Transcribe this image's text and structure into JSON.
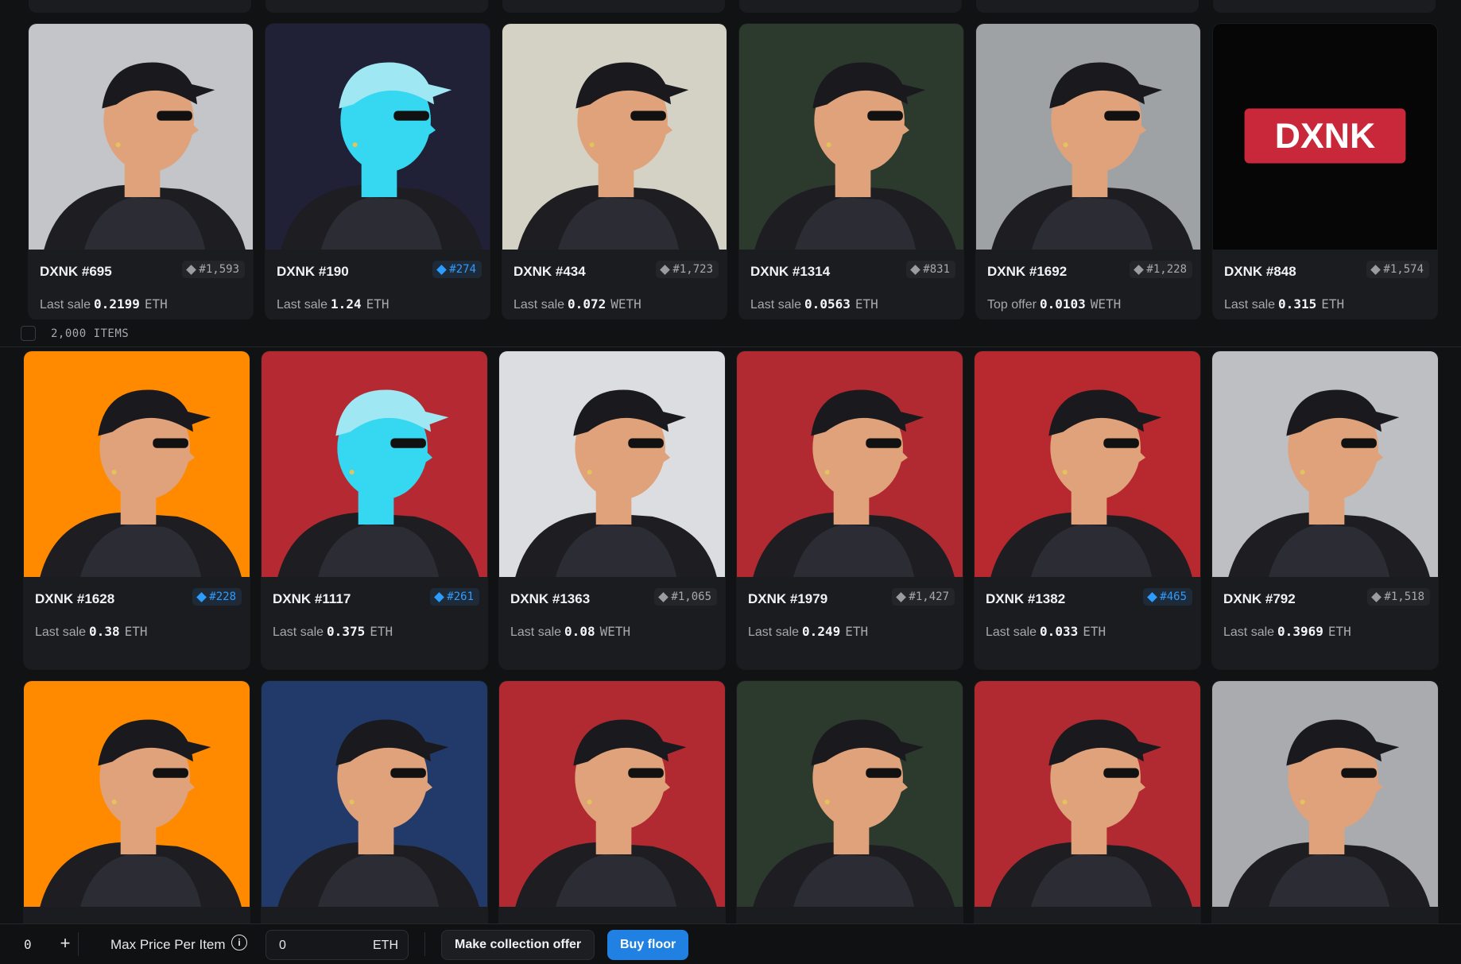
{
  "items_bar": {
    "count_label": "2,000 ITEMS"
  },
  "top_row": [
    {
      "name": "DXNK #695",
      "rank": "#1,593",
      "rank_blue": false,
      "sale_label": "Last sale",
      "price": "0.2199",
      "currency": "ETH",
      "bg": "#c3c5c8",
      "art": "person"
    },
    {
      "name": "DXNK #190",
      "rank": "#274",
      "rank_blue": true,
      "sale_label": "Last sale",
      "price": "1.24",
      "currency": "ETH",
      "bg": "#202036",
      "art": "skull"
    },
    {
      "name": "DXNK #434",
      "rank": "#1,723",
      "rank_blue": false,
      "sale_label": "Last sale",
      "price": "0.072",
      "currency": "WETH",
      "bg": "#d3d2c4",
      "art": "person"
    },
    {
      "name": "DXNK #1314",
      "rank": "#831",
      "rank_blue": false,
      "sale_label": "Last sale",
      "price": "0.0563",
      "currency": "ETH",
      "bg": "#2c3a2e",
      "art": "person"
    },
    {
      "name": "DXNK #1692",
      "rank": "#1,228",
      "rank_blue": false,
      "sale_label": "Top offer",
      "price": "0.0103",
      "currency": "WETH",
      "bg": "#9fa2a5",
      "art": "person"
    },
    {
      "name": "DXNK #848",
      "rank": "#1,574",
      "rank_blue": false,
      "sale_label": "Last sale",
      "price": "0.315",
      "currency": "ETH",
      "bg": "#060606",
      "art": "logo",
      "logo_text": "DXNK"
    }
  ],
  "middle_row": [
    {
      "name": "DXNK #1628",
      "rank": "#228",
      "rank_blue": true,
      "sale_label": "Last sale",
      "price": "0.38",
      "currency": "ETH",
      "bg": "#ff8a00",
      "art": "person"
    },
    {
      "name": "DXNK #1117",
      "rank": "#261",
      "rank_blue": true,
      "sale_label": "Last sale",
      "price": "0.375",
      "currency": "ETH",
      "bg": "#b52a32",
      "art": "skull"
    },
    {
      "name": "DXNK #1363",
      "rank": "#1,065",
      "rank_blue": false,
      "sale_label": "Last sale",
      "price": "0.08",
      "currency": "WETH",
      "bg": "#dcdde0",
      "art": "person"
    },
    {
      "name": "DXNK #1979",
      "rank": "#1,427",
      "rank_blue": false,
      "sale_label": "Last sale",
      "price": "0.249",
      "currency": "ETH",
      "bg": "#b22a31",
      "art": "person"
    },
    {
      "name": "DXNK #1382",
      "rank": "#465",
      "rank_blue": true,
      "sale_label": "Last sale",
      "price": "0.033",
      "currency": "ETH",
      "bg": "#b8282f",
      "art": "person"
    },
    {
      "name": "DXNK #792",
      "rank": "#1,518",
      "rank_blue": false,
      "sale_label": "Last sale",
      "price": "0.3969",
      "currency": "ETH",
      "bg": "#bdbfc2",
      "art": "person"
    }
  ],
  "bottom_row": [
    {
      "bg": "#ff8a00",
      "art": "person"
    },
    {
      "bg": "#223a6a",
      "art": "person"
    },
    {
      "bg": "#b22a31",
      "art": "person"
    },
    {
      "bg": "#2c3a2e",
      "art": "person"
    },
    {
      "bg": "#b22a31",
      "art": "person"
    },
    {
      "bg": "#a9abae",
      "art": "person"
    }
  ],
  "bottom_bar": {
    "quantity": "0",
    "plus": "+",
    "max_price_label": "Max Price Per Item",
    "info_glyph": "i",
    "price_value": "0",
    "price_currency": "ETH",
    "offer_button": "Make collection offer",
    "buy_button": "Buy floor",
    "buy_color": "#2081e2"
  }
}
